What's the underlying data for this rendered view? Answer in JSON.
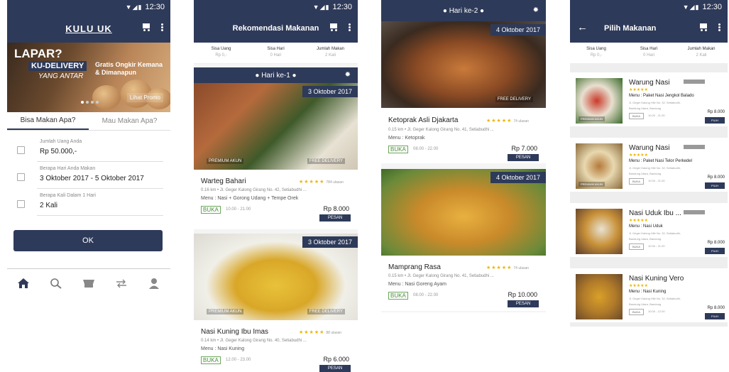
{
  "status": {
    "time": "12:30"
  },
  "screen1": {
    "logo": "KULU UK",
    "banner": {
      "headline": "LAPAR?",
      "brand": "KU-DELIVERY",
      "tagline": "YANG ANTAR",
      "promo_text": "Gratis Ongkir Kemana & Dimanapun",
      "promo_button": "Lihat Promo"
    },
    "tabs": [
      {
        "label": "Bisa Makan Apa?"
      },
      {
        "label": "Mau Makan Apa?"
      }
    ],
    "fields": [
      {
        "label": "Jumlah Uang Anda",
        "value": "Rp 50.000,-"
      },
      {
        "label": "Berapa Hari Anda Makan",
        "value": "3 Oktober 2017 - 5 Oktober 2017"
      },
      {
        "label": "Berapa Kali Dalam 1 Hari",
        "value": "2 Kali"
      }
    ],
    "ok_label": "OK"
  },
  "summary": [
    {
      "label": "Sisa Uang",
      "value": "Rp 0,-"
    },
    {
      "label": "Sisa Hari",
      "value": "0 Hari"
    },
    {
      "label": "Jumlah Makan",
      "value": "2 Kali"
    }
  ],
  "screen2": {
    "title": "Rekomendasi Makanan",
    "day": "Hari ke-1",
    "cards": [
      {
        "date": "3 Oktober 2017",
        "tag_left": "PREMIUM AKUN",
        "tag_right": "FREE DELIVERY",
        "name": "Warteg Bahari",
        "stars": "★★★★★",
        "ulasan": "784 ulasan",
        "address": "0.16 km • Jl. Geger Kalong Girang No. 42, Setiabudhi ...",
        "menu": "Menu : Nasi + Gorong Udang + Tempe Orek",
        "status": "BUKA",
        "hours": "10.00 - 21.00",
        "price": "Rp 8.000",
        "order": "PESAN"
      },
      {
        "date": "3 Oktober 2017",
        "tag_left": "PREMIUM AKUN",
        "tag_right": "FREE DELIVERY",
        "name": "Nasi Kuning Ibu Imas",
        "stars": "★★★★★",
        "ulasan": "88 ulasan",
        "address": "0.14 km • Jl. Geger Kalong Girang No. 40, Setiabudhi ...",
        "menu": "Menu : Nasi Kuning",
        "status": "BUKA",
        "hours": "12.00 - 23.00",
        "price": "Rp 6.000",
        "order": "PESAN"
      }
    ]
  },
  "screen3": {
    "day": "Hari ke-2",
    "cards": [
      {
        "date": "4 Oktober 2017",
        "tag_right": "FREE DELIVERY",
        "name": "Ketoprak Asli Djakarta",
        "stars": "★★★★★",
        "ulasan": "74 ulasan",
        "address": "0.15 km • Jl. Geger Kalong Girang No. 41, Setiabudhi ...",
        "menu": "Menu : Ketoprak",
        "status": "BUKA",
        "hours": "08.00 - 22.00",
        "price": "Rp 7.000",
        "order": "PESAN"
      },
      {
        "date": "4 Oktober 2017",
        "name": "Mamprang Rasa",
        "stars": "★★★★★",
        "ulasan": "74 ulasan",
        "address": "0.15 km • Jl. Geger Kalong Girang No. 41, Setiabudhi ...",
        "menu": "Menu : Nasi Goreng Ayam",
        "status": "BUKA",
        "hours": "08.00 - 22.00",
        "price": "Rp 10.000",
        "order": "PESAN"
      }
    ]
  },
  "screen4": {
    "title": "Pilih Makanan",
    "items": [
      {
        "name": "Warung Nasi",
        "stars": "★★★★★",
        "menu": "Menu : Paket Nasi Jengkol Balado",
        "address": "Jl. Geger Kalong Hilir No. 32, Setiabudhi, Bandung Utara, Bandung",
        "status": "BUKA",
        "hours": "10.00 - 21.00",
        "price": "Rp 8.000",
        "pick": "PILIH",
        "tag": "PREMIUM AKUN"
      },
      {
        "name": "Warung Nasi",
        "stars": "★★★★★",
        "menu": "Menu : Paket Nasi Telor Perkedel",
        "address": "Jl. Geger Kalong Hilir No. 32, Setiabudhi, Bandung Utara, Bandung",
        "status": "BUKA",
        "hours": "10.00 - 21.00",
        "price": "Rp 8.000",
        "pick": "PILIH",
        "tag": "PREMIUM AKUN"
      },
      {
        "name": "Nasi Uduk Ibu ...",
        "stars": "★★★★★",
        "menu": "Menu : Nasi Uduk",
        "address": "Jl. Geger Kalong Hilir No. 32, Setiabudhi, Bandung Utara, Bandung",
        "status": "BUKA",
        "hours": "10.00 - 21.00",
        "price": "Rp 8.000",
        "pick": "PILIH"
      },
      {
        "name": "Nasi Kuning Vero",
        "stars": "★★★★★",
        "menu": "Menu : Nasi Kuning",
        "address": "Jl. Geger Kalong Hilir No. 32, Setiabudhi, Bandung Utara, Bandung",
        "status": "BUKA",
        "hours": "10.00 - 12.00",
        "price": "Rp 8.000",
        "pick": "PILIH"
      }
    ]
  }
}
